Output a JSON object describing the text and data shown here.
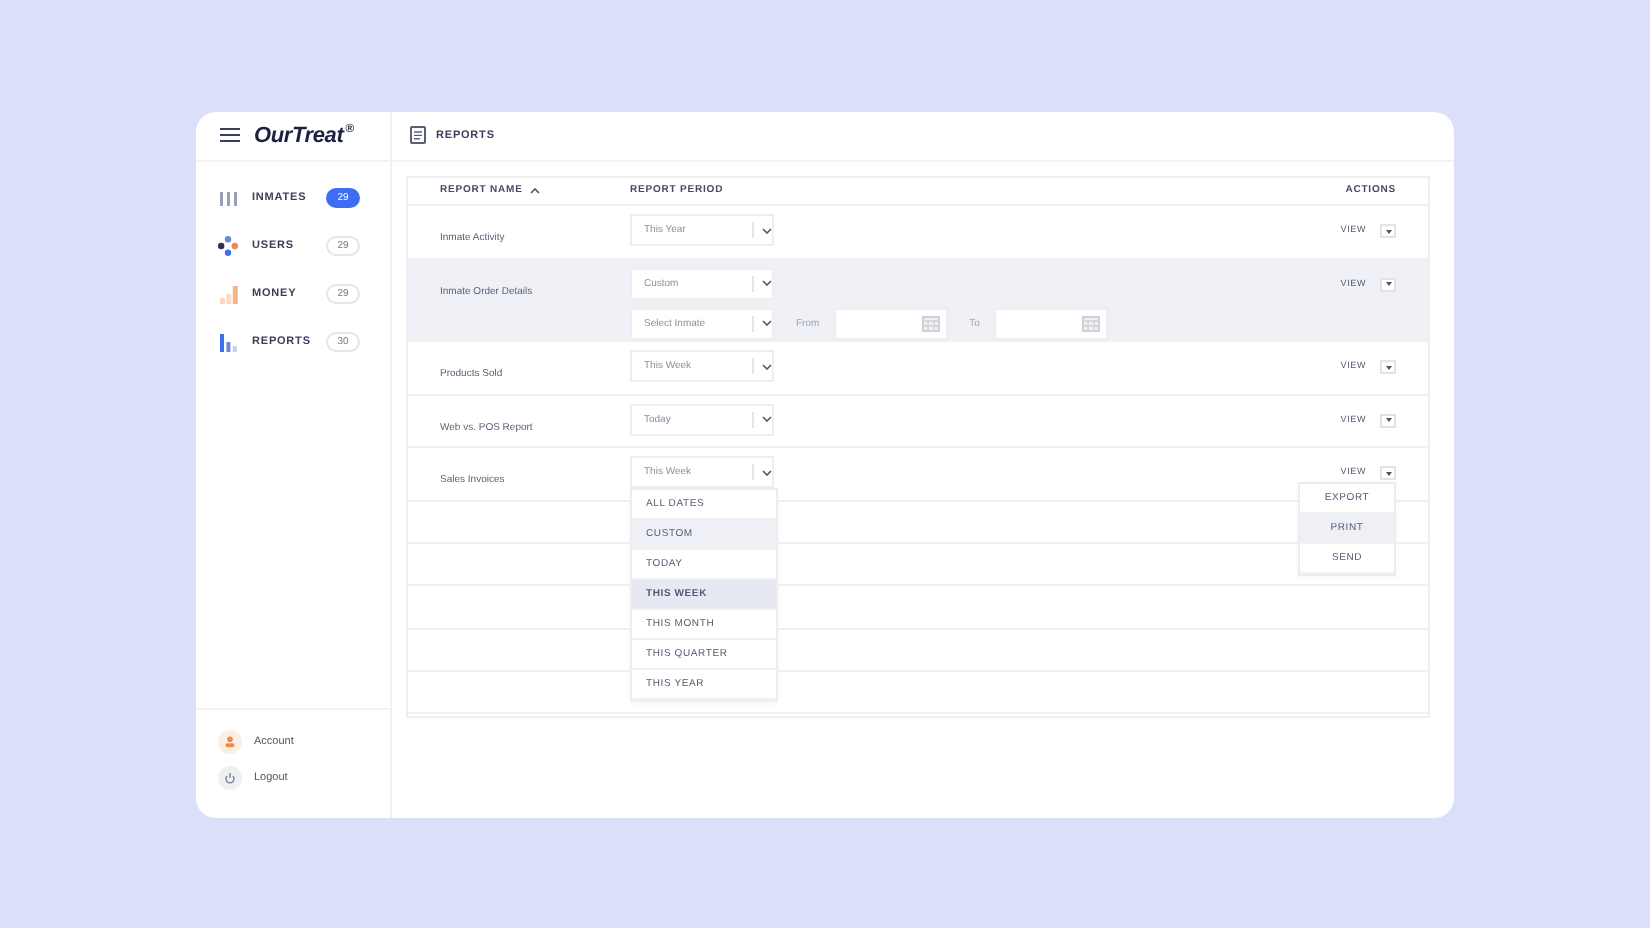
{
  "app": {
    "logo": "OurTreat",
    "logo_mark": "®"
  },
  "sidebar": {
    "items": [
      {
        "label": "INMATES",
        "count": "29",
        "selected": true
      },
      {
        "label": "USERS",
        "count": "29",
        "selected": false
      },
      {
        "label": "MONEY",
        "count": "29",
        "selected": false
      },
      {
        "label": "REPORTS",
        "count": "30",
        "selected": false
      }
    ],
    "footer": [
      {
        "label": "Account"
      },
      {
        "label": "Logout"
      }
    ]
  },
  "header": {
    "title": "REPORTS"
  },
  "table": {
    "columns": [
      {
        "label": "REPORT NAME",
        "sorted": true
      },
      {
        "label": "REPORT PERIOD"
      },
      {
        "label": "ACTIONS"
      }
    ],
    "rows": [
      {
        "name": "Inmate Activity",
        "period": "This Year",
        "action": "VIEW",
        "selected": false
      },
      {
        "name": "Inmate Order Details",
        "period": "Custom",
        "action": "VIEW",
        "selected": true,
        "custom": {
          "inmate_placeholder": "Select Inmate",
          "from_label": "From",
          "to_label": "To"
        }
      },
      {
        "name": "Products Sold",
        "period": "This Week",
        "action": "VIEW",
        "selected": false
      },
      {
        "name": "Web vs. POS Report",
        "period": "Today",
        "action": "VIEW",
        "selected": false
      },
      {
        "name": "Sales Invoices",
        "period": "This Week",
        "action": "VIEW",
        "selected": false,
        "period_options": [
          {
            "label": "ALL DATES",
            "selected": false,
            "hovered": false
          },
          {
            "label": "CUSTOM",
            "selected": false,
            "hovered": true
          },
          {
            "label": "TODAY",
            "selected": false,
            "hovered": false
          },
          {
            "label": "THIS WEEK",
            "selected": true,
            "hovered": false
          },
          {
            "label": "THIS MONTH",
            "selected": false,
            "hovered": false
          },
          {
            "label": "THIS QUARTER",
            "selected": false,
            "hovered": false
          },
          {
            "label": "THIS YEAR",
            "selected": false,
            "hovered": false
          }
        ],
        "action_menu": [
          {
            "label": "EXPORT",
            "hovered": false
          },
          {
            "label": "PRINT",
            "hovered": true
          },
          {
            "label": "SEND",
            "hovered": false
          }
        ]
      }
    ]
  }
}
